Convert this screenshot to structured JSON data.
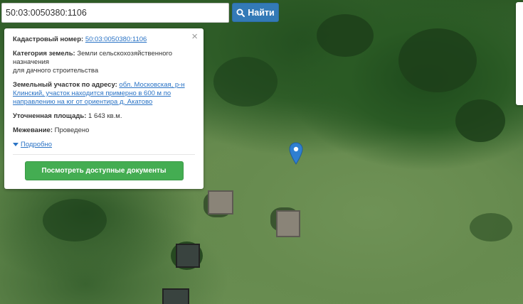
{
  "search": {
    "value": "50:03:0050380:1106",
    "button_label": "Найти"
  },
  "popup": {
    "close_glyph": "×",
    "cadastral_label": "Кадастровый номер:",
    "cadastral_number": "50:03:0050380:1106",
    "category_label": "Категория земель:",
    "category_value_line1": "Земли сельскохозяйственного",
    "category_value_line2": "назначения",
    "category_value_line3": "для дачного строительства",
    "address_label": "Земельный участок по адресу:",
    "address_line1": "обл. Московская, р-н",
    "address_line2": "Клинский, участок находится примерно в 600 м по",
    "address_line3": "направлению на юг от ориентира д. Акатово",
    "area_label": "Уточненная площадь:",
    "area_value": "1 643 кв.м.",
    "survey_label": "Межевание:",
    "survey_value": "Проведено",
    "more_label": "Подробно",
    "docs_button_label": "Посмотреть доступные документы"
  },
  "colors": {
    "search_button": "#337ab7",
    "docs_button": "#44ad52",
    "link": "#2a73c5",
    "marker": "#2f7fd1"
  },
  "icons": {
    "search": "magnifier-icon",
    "marker": "map-pin-icon",
    "close": "close-icon",
    "expand": "triangle-down-icon"
  }
}
